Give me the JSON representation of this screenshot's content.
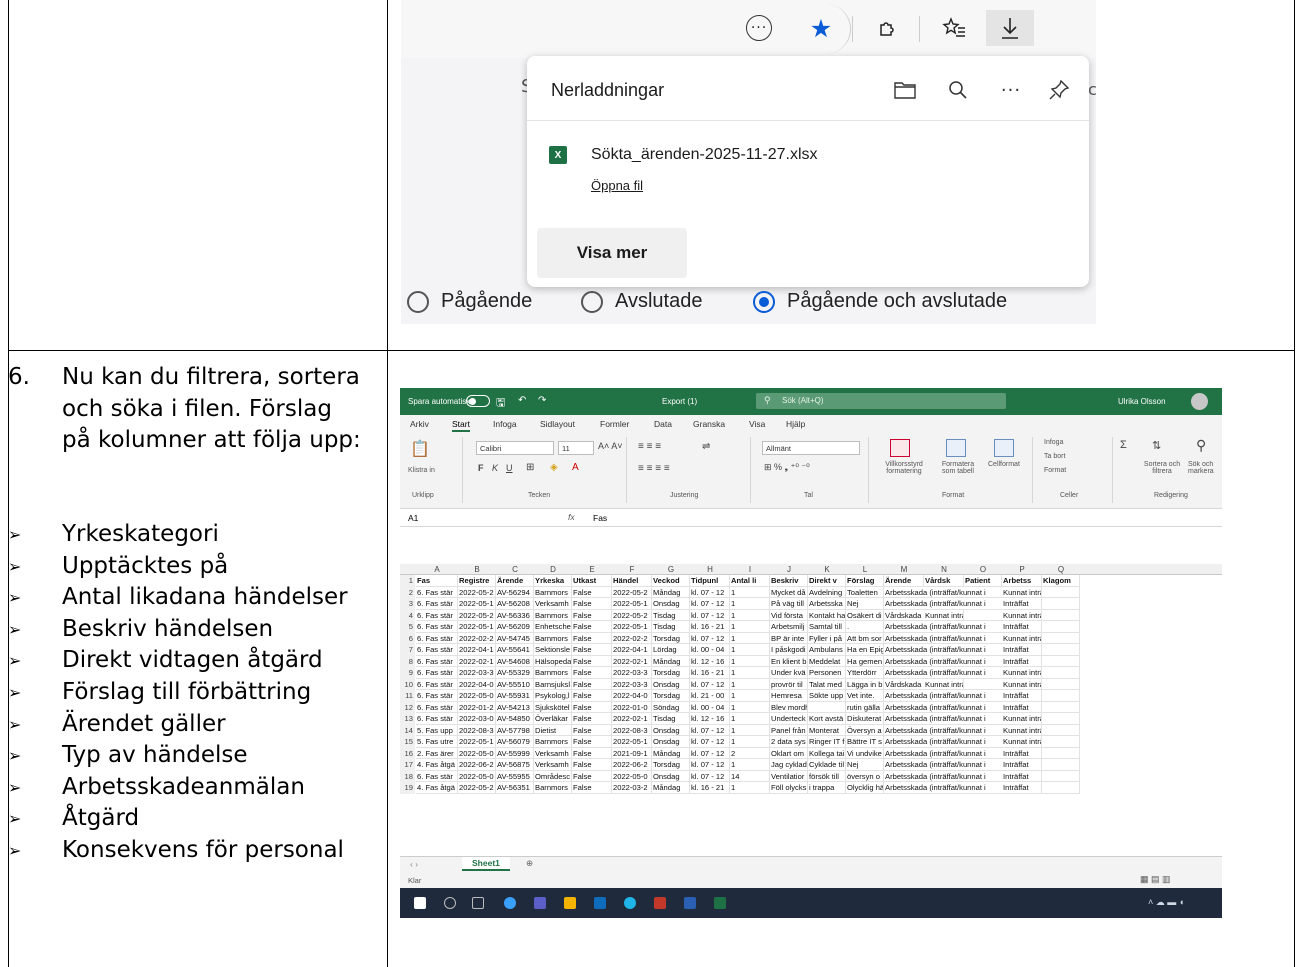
{
  "downloads": {
    "panel_title": "Nerladdningar",
    "file_name": "Sökta_ärenden-2025-11-27.xlsx",
    "file_icon": "excel-file-icon",
    "open_link": "Öppna fil",
    "show_more": "Visa mer",
    "bg_text": "S",
    "bg_text_right": "c",
    "toolbar_icons": [
      "more-dots-icon",
      "favorite-star-icon",
      "extensions-icon",
      "favorites-list-icon",
      "download-icon"
    ],
    "accent_color": "#0a5bd6"
  },
  "radio_options": [
    {
      "label": "Pågående",
      "checked": false
    },
    {
      "label": "Avslutade",
      "checked": false
    },
    {
      "label": "Pågående och avslutade",
      "checked": true
    }
  ],
  "step": {
    "number": "6.",
    "text": "Nu kan du filtrera, sortera och söka i filen. Förslag på kolumner att följa upp:"
  },
  "bullets": [
    "Yrkeskategori",
    "Upptäcktes på",
    "Antal likadana händelser",
    "Beskriv händelsen",
    "Direkt vidtagen åtgärd",
    "Förslag till förbättring",
    "Ärendet gäller",
    "Typ av händelse",
    "Arbetsskadeanmälan",
    "Åtgärd",
    "Konsekvens för personal"
  ],
  "excel": {
    "autosave_label": "Spara automatiskt",
    "file_title": "Export (1)",
    "search_placeholder": "Sök (Alt+Q)",
    "user_name": "Ulrika Olsson",
    "menu": [
      "Arkiv",
      "Start",
      "Infoga",
      "Sidlayout",
      "Formler",
      "Data",
      "Granska",
      "Visa",
      "Hjälp"
    ],
    "active_menu": "Start",
    "font_name": "Calibri",
    "font_size": "11",
    "number_format": "Allmänt",
    "ribbon_groups": [
      "Urklipp",
      "Tecken",
      "Justering",
      "Tal",
      "Format",
      "Celler",
      "Redigering"
    ],
    "ribbon_labels": {
      "paste": "Klistra in",
      "cond_format": "Villkorsstyrd formatering",
      "format_table": "Formatera som tabell",
      "cell_format": "Cellformat",
      "insert": "Infoga",
      "delete": "Ta bort",
      "format": "Format",
      "sort_filter": "Sortera och filtrera",
      "find": "Sök och markera"
    },
    "name_box": "A1",
    "formula_value": "Fas",
    "columns": [
      "A",
      "B",
      "C",
      "D",
      "E",
      "F",
      "G",
      "H",
      "I",
      "J",
      "K",
      "L",
      "M",
      "N",
      "O",
      "P",
      "Q"
    ],
    "header_row": [
      "Fas",
      "Registre",
      "Ärende",
      "Yrkeska",
      "Utkast",
      "Händel",
      "Veckod",
      "Tidpunl",
      "Antal li",
      "Beskriv",
      "Direkt v",
      "Förslag",
      "Ärende",
      "Vårdsk",
      "Patient",
      "Arbetss",
      "Klagom"
    ],
    "rows": [
      [
        "6. Fas stär",
        "2022-05-2",
        "AV-56294",
        "Barnmors",
        "False",
        "2022-05-2",
        "Måndag",
        "kl. 07 - 12",
        "1",
        "Mycket då",
        "Avdelning",
        "Toaletten",
        "Arbetsskada (inträffat/kunnat i",
        "",
        "",
        "Kunnat inträffa",
        ""
      ],
      [
        "6. Fas stär",
        "2022-05-1",
        "AV-56208",
        "Verksamh",
        "False",
        "2022-05-1",
        "Onsdag",
        "kl. 07 - 12",
        "1",
        "På väg till",
        "Arbetsska",
        "Nej",
        "Arbetsskada (inträffat/kunnat i",
        "",
        "",
        "Inträffat",
        ""
      ],
      [
        "6. Fas stär",
        "2022-05-2",
        "AV-56336",
        "Barnmors",
        "False",
        "2022-05-2",
        "Tisdag",
        "kl. 07 - 12",
        "1",
        "Vid första",
        "Kontakt ha",
        "Osäkert di",
        "Vårdskada",
        "Kunnat inträffa",
        "",
        "Kunnat inträffa",
        ""
      ],
      [
        "6. Fas stär",
        "2022-05-1",
        "AV-56209",
        "Enhetsche",
        "False",
        "2022-05-1",
        "Tisdag",
        "kl. 16 - 21",
        "1",
        "Arbetsmilj",
        "Samtal till",
        ".",
        "Arbetsskada (inträffat/kunnat i",
        "",
        "",
        "Inträffat",
        ""
      ],
      [
        "6. Fas stär",
        "2022-02-2",
        "AV-54745",
        "Barnmors",
        "False",
        "2022-02-2",
        "Torsdag",
        "kl. 07 - 12",
        "1",
        "BP är inte",
        "Fyller i på",
        "Att bm sor",
        "Arbetsskada (inträffat/kunnat i",
        "",
        "",
        "Kunnat inträffa",
        ""
      ],
      [
        "6. Fas stär",
        "2022-04-1",
        "AV-55641",
        "Sektionsle",
        "False",
        "2022-04-1",
        "Lördag",
        "kl. 00 - 04",
        "1",
        "I påskgodi",
        "Ambulans",
        "Ha en Epig",
        "Arbetsskada (inträffat/kunnat i",
        "",
        "",
        "Inträffat",
        ""
      ],
      [
        "6. Fas stär",
        "2022-02-1",
        "AV-54608",
        "Hälsopeda",
        "False",
        "2022-02-1",
        "Måndag",
        "kl. 12 - 16",
        "1",
        "En klient b",
        "Meddelat",
        "Ha gemen",
        "Arbetsskada (inträffat/kunnat i",
        "",
        "",
        "Inträffat",
        ""
      ],
      [
        "6. Fas stär",
        "2022-03-3",
        "AV-55329",
        "Barnmors",
        "False",
        "2022-03-3",
        "Torsdag",
        "kl. 16 - 21",
        "1",
        "Under kvä",
        "Personen",
        "Ytterdörr",
        "Arbetsskada (inträffat/kunnat i",
        "",
        "",
        "Kunnat inträffa",
        ""
      ],
      [
        "6. Fas stär",
        "2022-04-0",
        "AV-55510",
        "Barnsjuksl",
        "False",
        "2022-03-3",
        "Onsdag",
        "kl. 07 - 12",
        "1",
        "provrör til",
        "Talat med",
        "Lägga in b",
        "Vårdskada",
        "Kunnat inträffa",
        "",
        "Kunnat inträffa",
        ""
      ],
      [
        "6. Fas stär",
        "2022-05-0",
        "AV-55931",
        "Psykolog,l",
        "False",
        "2022-04-0",
        "Torsdag",
        "kl. 21 - 00",
        "1",
        "Hemresa",
        "Sökte upp",
        "Vet inte.",
        "Arbetsskada (inträffat/kunnat i",
        "",
        "",
        "Inträffat",
        ""
      ],
      [
        "6. Fas stär",
        "2022-01-2",
        "AV-54213",
        "Sjukskötel",
        "False",
        "2022-01-0",
        "Söndag",
        "kl. 00 - 04",
        "1",
        "Blev mordhotad und",
        "",
        "rutin gälla",
        "Arbetsskada (inträffat/kunnat i",
        "",
        "",
        "Inträffat",
        ""
      ],
      [
        "6. Fas stär",
        "2022-03-0",
        "AV-54850",
        "Överläkar",
        "False",
        "2022-02-1",
        "Tisdag",
        "kl. 12 - 16",
        "1",
        "Underteck",
        "Kort avstä",
        "Diskuterat",
        "Arbetsskada (inträffat/kunnat i",
        "",
        "",
        "Kunnat inträffa",
        ""
      ],
      [
        "5. Fas upp",
        "2022-08-3",
        "AV-57798",
        "Dietist",
        "False",
        "2022-08-3",
        "Onsdag",
        "kl. 07 - 12",
        "1",
        "Panel från",
        "Monterat",
        "Översyn a",
        "Arbetsskada (inträffat/kunnat i",
        "",
        "",
        "Kunnat inträffa",
        ""
      ],
      [
        "5. Fas utre",
        "2022-05-1",
        "AV-56079",
        "Barnmors",
        "False",
        "2022-05-1",
        "Onsdag",
        "kl. 07 - 12",
        "1",
        "2 data sys",
        "Ringer IT f",
        "Bättre IT s",
        "Arbetsskada (inträffat/kunnat i",
        "",
        "",
        "Kunnat inträffa",
        ""
      ],
      [
        "2. Fas ärer",
        "2022-05-0",
        "AV-55999",
        "Verksamh",
        "False",
        "2021-09-1",
        "Måndag",
        "kl. 07 - 12",
        "2",
        "Oklart om",
        "Kollega tai",
        "Vi undvike",
        "Arbetsskada (inträffat/kunnat i",
        "",
        "",
        "Inträffat",
        ""
      ],
      [
        "4. Fas åtgä",
        "2022-06-2",
        "AV-56875",
        "Verksamh",
        "False",
        "2022-06-2",
        "Torsdag",
        "kl. 07 - 12",
        "1",
        "Jag cyklad",
        "Cyklade til",
        "Nej",
        "Arbetsskada (inträffat/kunnat i",
        "",
        "",
        "Inträffat",
        ""
      ],
      [
        "6. Fas stär",
        "2022-05-0",
        "AV-55955",
        "Områdesc",
        "False",
        "2022-05-0",
        "Onsdag",
        "kl. 07 - 12",
        "14",
        "Ventilatior",
        "försök till",
        "översyn o",
        "Arbetsskada (inträffat/kunnat i",
        "",
        "",
        "Inträffat",
        ""
      ],
      [
        "4. Fas åtgä",
        "2022-05-2",
        "AV-56351",
        "Barnmors",
        "False",
        "2022-03-2",
        "Måndag",
        "kl. 16 - 21",
        "1",
        "Föll olycksl",
        "i trappa",
        "Olycklig hä",
        "Arbetsskada (inträffat/kunnat i",
        "",
        "",
        "Inträffat",
        ""
      ]
    ],
    "sheet_tab": "Sheet1",
    "status_text": "Klar",
    "accent_color": "#217346"
  }
}
